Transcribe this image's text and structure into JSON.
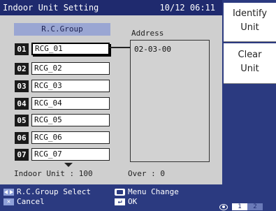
{
  "titlebar": {
    "title": "Indoor Unit Setting",
    "clock": "10/12 06:11"
  },
  "panel": {
    "rc_group_header": "R.C.Group",
    "address_label": "Address",
    "address_value": "02-03-00",
    "rows": [
      {
        "num": "01",
        "name": "RCG_01",
        "selected": true
      },
      {
        "num": "02",
        "name": "RCG_02",
        "selected": false
      },
      {
        "num": "03",
        "name": "RCG_03",
        "selected": false
      },
      {
        "num": "04",
        "name": "RCG_04",
        "selected": false
      },
      {
        "num": "05",
        "name": "RCG_05",
        "selected": false
      },
      {
        "num": "06",
        "name": "RCG_06",
        "selected": false
      },
      {
        "num": "07",
        "name": "RCG_07",
        "selected": false
      }
    ],
    "indoor_unit_text": "Indoor Unit : 100",
    "over_text": "Over : 0"
  },
  "side_buttons": {
    "identify": [
      "Identify",
      "Unit"
    ],
    "clear": [
      "Clear",
      "Unit"
    ]
  },
  "footer": {
    "rc_group_select": "R.C.Group Select",
    "cancel": "Cancel",
    "menu_change": "Menu Change",
    "ok": "OK",
    "pages": [
      "1",
      "2"
    ],
    "active_page": "1"
  },
  "colors": {
    "background": "#2b3a80",
    "titlebar": "#1f2a6e",
    "panel": "#cfcfcf",
    "header": "#9aa6d3"
  }
}
